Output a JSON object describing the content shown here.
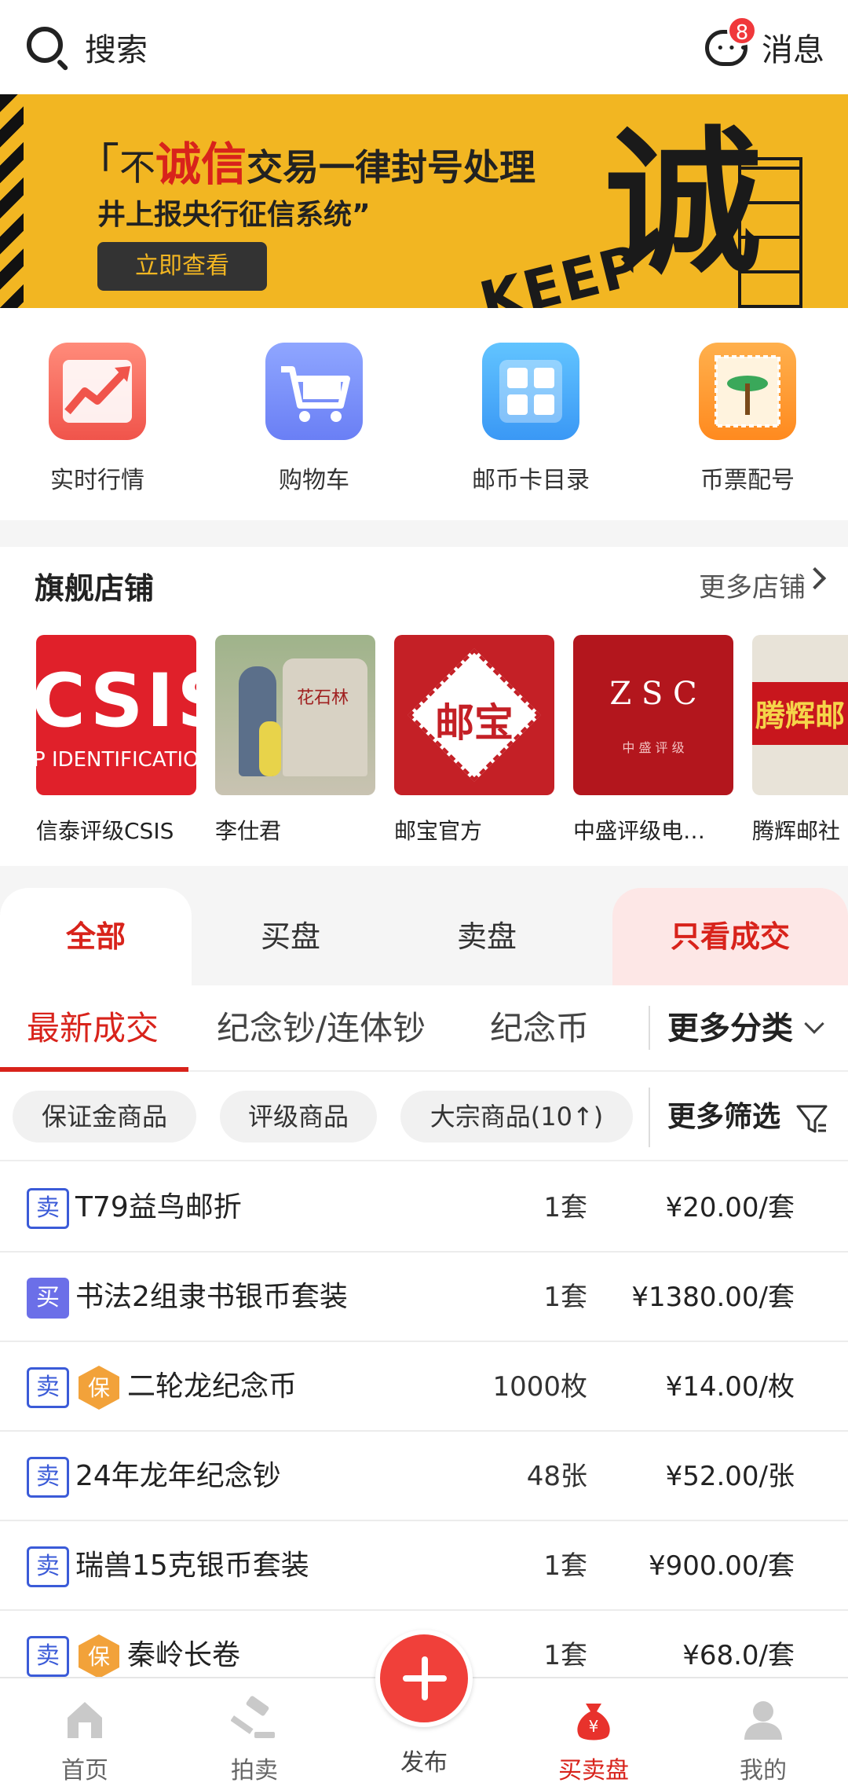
{
  "header": {
    "search_label": "搜索",
    "messages_label": "消息",
    "message_badge": "8"
  },
  "banner": {
    "line1_prefix": "不",
    "line1_red": "诚信",
    "line1_rest": "交易一律封号处理",
    "line2": "井上报央行征信系统”",
    "button": "立即查看",
    "keep_text": "KEEP",
    "big_char": "诚"
  },
  "quick": [
    {
      "label": "实时行情",
      "icon": "trend-chart-icon"
    },
    {
      "label": "购物车",
      "icon": "shopping-cart-icon"
    },
    {
      "label": "邮币卡目录",
      "icon": "catalog-grid-icon"
    },
    {
      "label": "币票配号",
      "icon": "stamp-icon"
    }
  ],
  "flagship": {
    "title": "旗舰店铺",
    "more": "更多店铺",
    "stores": [
      {
        "name": "信泰评级CSIS",
        "logo_text": "CSIS",
        "logo_sub": "P IDENTIFICATIO"
      },
      {
        "name": "李仕君",
        "photo_text": "花石林"
      },
      {
        "name": "邮宝官方",
        "logo_text": "邮宝"
      },
      {
        "name": "中盛评级电…",
        "logo_text": "Z S C",
        "logo_sub": "中 盛 评 级"
      },
      {
        "name": "腾辉邮社",
        "logo_text": "腾辉邮"
      }
    ]
  },
  "segments": {
    "all": "全部",
    "buy": "买盘",
    "sell": "卖盘",
    "only_deals": "只看成交"
  },
  "tabs": {
    "latest": "最新成交",
    "notes": "纪念钞/连体钞",
    "coins": "纪念币",
    "more": "更多分类"
  },
  "filters": {
    "deposit": "保证金商品",
    "graded": "评级商品",
    "bulk": "大宗商品(10↑)",
    "more": "更多筛选"
  },
  "rows": [
    {
      "tag": "卖",
      "type": "sell",
      "bao": false,
      "name": "T79益鸟邮折",
      "qty": "1套",
      "price": "¥20.00/套"
    },
    {
      "tag": "买",
      "type": "buy",
      "bao": false,
      "name": "书法2组隶书银币套装",
      "qty": "1套",
      "price": "¥1380.00/套"
    },
    {
      "tag": "卖",
      "type": "sell",
      "bao": true,
      "name": "二轮龙纪念币",
      "qty": "1000枚",
      "price": "¥14.00/枚"
    },
    {
      "tag": "卖",
      "type": "sell",
      "bao": false,
      "name": "24年龙年纪念钞",
      "qty": "48张",
      "price": "¥52.00/张"
    },
    {
      "tag": "卖",
      "type": "sell",
      "bao": false,
      "name": "瑞兽15克银币套装",
      "qty": "1套",
      "price": "¥900.00/套"
    },
    {
      "tag": "卖",
      "type": "sell",
      "bao": true,
      "name": "秦岭长卷",
      "qty": "1套",
      "price": "¥68.0/套"
    }
  ],
  "bao_label": "保",
  "nav": {
    "home": "首页",
    "auction": "拍卖",
    "publish": "发布",
    "market": "买卖盘",
    "mine": "我的"
  },
  "colors": {
    "accent": "#d8231b",
    "sell_tag": "#3b5bd8",
    "buy_tag": "#6b6fe8",
    "banner_yellow": "#f2b622"
  }
}
